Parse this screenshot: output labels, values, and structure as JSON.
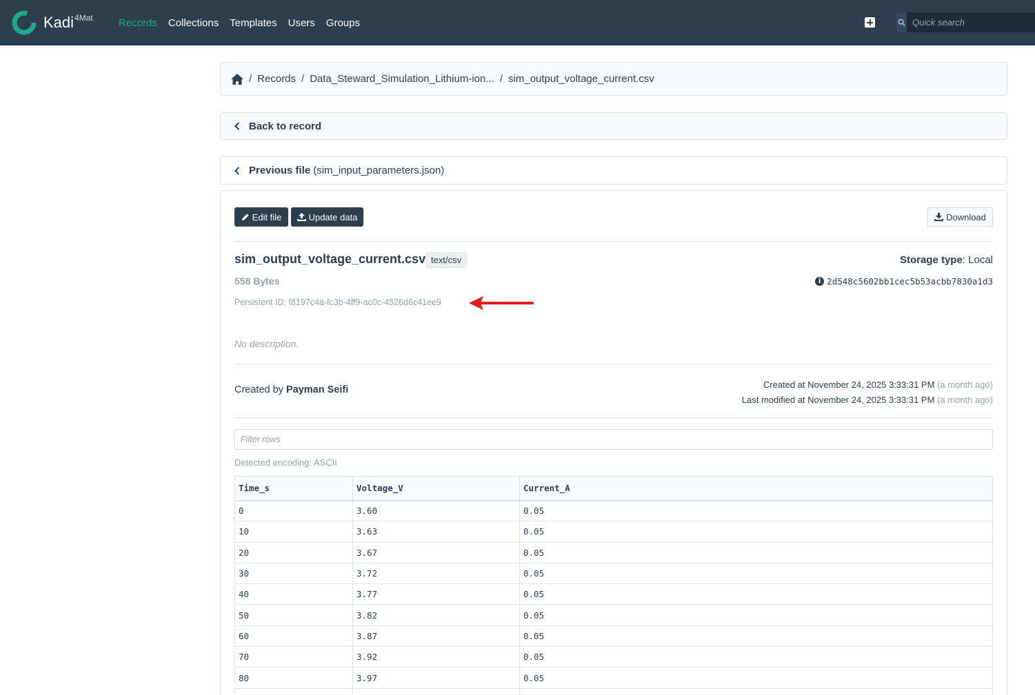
{
  "navbar": {
    "brand": "Kadi",
    "brand_sup": "4Mat",
    "links": [
      "Records",
      "Collections",
      "Templates",
      "Users",
      "Groups"
    ],
    "active_link": "Records",
    "search_placeholder": "Quick search",
    "icons": [
      "kadi-logo-icon",
      "plus-square-icon",
      "search-icon"
    ]
  },
  "breadcrumb": {
    "items": [
      "Records",
      "Data_Steward_Simulation_Lithium-ion..."
    ],
    "current": "sim_output_voltage_current.csv",
    "separator": "/"
  },
  "back_link": "Back to record",
  "prev_file": {
    "label": "Previous file",
    "name": "(sim_input_parameters.json)"
  },
  "actions": {
    "edit": "Edit file",
    "update": "Update data",
    "download": "Download"
  },
  "file": {
    "name": "sim_output_voltage_current.csv",
    "mime": "text/csv",
    "size": "558 Bytes",
    "persistent_id": "Persistent ID: f8197c4a-fc3b-4ff9-ac0c-4526d6c41ee9",
    "storage_label": "Storage type",
    "storage_value": "Local",
    "checksum": "2d548c5602bb1cec5b53acbb7830a1d3",
    "description": "No description.",
    "created_by_label": "Created by",
    "created_by": "Payman Seifi",
    "created_at": "Created at November 24, 2025 3:33:31 PM",
    "created_rel": "(a month ago)",
    "modified_at": "Last modified at November 24, 2025 3:33:31 PM",
    "modified_rel": "(a month ago)"
  },
  "table": {
    "filter_placeholder": "Filter rows",
    "encoding": "Detected encoding: ASCII",
    "headers": [
      "Time_s",
      "Voltage_V",
      "Current_A"
    ],
    "rows": [
      [
        "0",
        "3.60",
        "0.05"
      ],
      [
        "10",
        "3.63",
        "0.05"
      ],
      [
        "20",
        "3.67",
        "0.05"
      ],
      [
        "30",
        "3.72",
        "0.05"
      ],
      [
        "40",
        "3.77",
        "0.05"
      ],
      [
        "50",
        "3.82",
        "0.05"
      ],
      [
        "60",
        "3.87",
        "0.05"
      ],
      [
        "70",
        "3.92",
        "0.05"
      ],
      [
        "80",
        "3.97",
        "0.05"
      ],
      [
        "",
        "",
        ""
      ]
    ]
  },
  "colors": {
    "navbar_bg": "#2c3e50",
    "accent": "#1fa78b",
    "muted": "#95a5a6",
    "annotation_arrow": "#e31b1b"
  }
}
